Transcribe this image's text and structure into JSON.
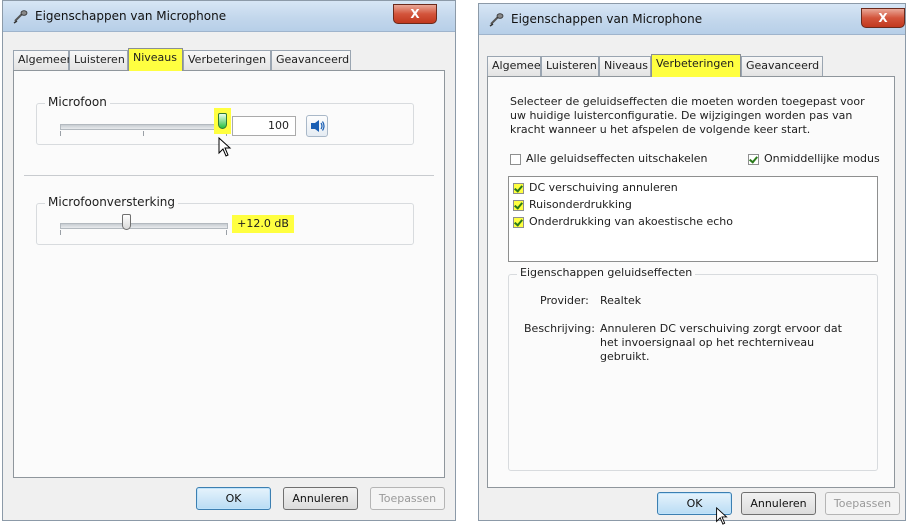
{
  "left_dialog": {
    "title": "Eigenschappen van Microphone",
    "close_glyph": "X",
    "tabs": [
      "Algemeen",
      "Luisteren",
      "Niveaus",
      "Verbeteringen",
      "Geavanceerd"
    ],
    "active_tab": "Niveaus",
    "microfoon": {
      "label": "Microfoon",
      "value": "100",
      "level_fraction": 1.0
    },
    "versterking": {
      "label": "Microfoonversterking",
      "value": "+12.0 dB",
      "level_fraction": 0.4
    },
    "buttons": {
      "ok": "OK",
      "cancel": "Annuleren",
      "apply": "Toepassen"
    }
  },
  "right_dialog": {
    "title": "Eigenschappen van Microphone",
    "close_glyph": "X",
    "tabs": [
      "Algemeen",
      "Luisteren",
      "Niveaus",
      "Verbeteringen",
      "Geavanceerd"
    ],
    "active_tab": "Verbeteringen",
    "intro": "Selecteer de geluidseffecten die moeten worden toegepast voor uw huidige luisterconfiguratie. De wijzigingen worden pas van kracht wanneer u het afspelen de volgende keer start.",
    "disable_all": {
      "label": "Alle geluidseffecten uitschakelen",
      "checked": false
    },
    "immediate": {
      "label": "Onmiddellijke modus",
      "checked": true
    },
    "effects": [
      {
        "label": "DC verschuiving annuleren",
        "checked": true
      },
      {
        "label": "Ruisonderdrukking",
        "checked": true
      },
      {
        "label": "Onderdrukking van akoestische echo",
        "checked": true
      }
    ],
    "properties": {
      "group_label": "Eigenschappen geluidseffecten",
      "provider_label": "Provider:",
      "provider_value": "Realtek",
      "description_label": "Beschrijving:",
      "description_value": "Annuleren DC verschuiving zorgt ervoor dat het invoersignaal op het rechterniveau gebruikt."
    },
    "buttons": {
      "ok": "OK",
      "cancel": "Annuleren",
      "apply": "Toepassen"
    }
  },
  "colors": {
    "highlight": "#ffff40",
    "panel": "#fbfbfb",
    "dialog": "#f0f0f0"
  },
  "icons": [
    "microphone-icon",
    "close-icon",
    "speaker-icon",
    "mouse-pointer-icon",
    "checkmark-icon"
  ]
}
